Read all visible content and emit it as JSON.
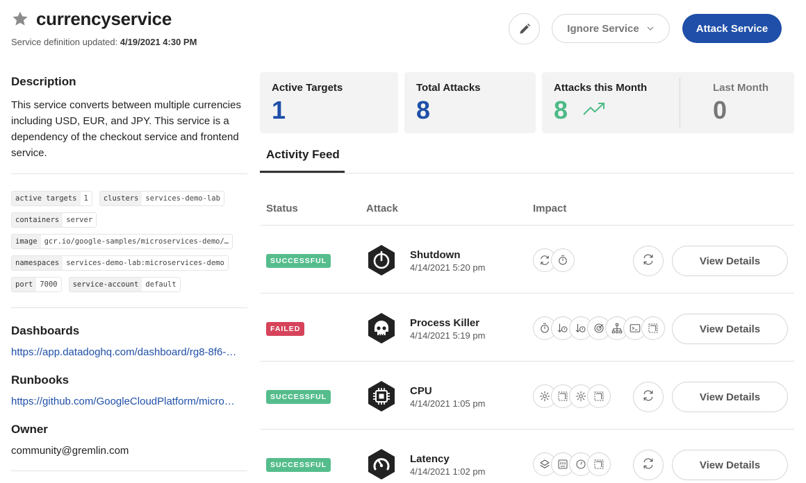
{
  "header": {
    "title": "currencyservice",
    "updated_label": "Service definition updated:",
    "updated_value": "4/19/2021 4:30 PM",
    "ignore_label": "Ignore Service",
    "attack_label": "Attack Service"
  },
  "description": {
    "heading": "Description",
    "text": "This service converts between multiple currencies including USD, EUR, and JPY. This service is a dependency of the checkout service and frontend service."
  },
  "tags": [
    {
      "key": "active targets",
      "value": "1"
    },
    {
      "key": "clusters",
      "value": "services-demo-lab"
    },
    {
      "key": "containers",
      "value": "server"
    },
    {
      "key": "image",
      "value": "gcr.io/google-samples/microservices-demo/…"
    },
    {
      "key": "namespaces",
      "value": "services-demo-lab:microservices-demo"
    },
    {
      "key": "port",
      "value": "7000"
    },
    {
      "key": "service-account",
      "value": "default"
    }
  ],
  "dashboards": {
    "heading": "Dashboards",
    "link": "https://app.datadoghq.com/dashboard/rg8-8f6-…"
  },
  "runbooks": {
    "heading": "Runbooks",
    "link": "https://github.com/GoogleCloudPlatform/micro…"
  },
  "owner": {
    "heading": "Owner",
    "value": "community@gremlin.com"
  },
  "stats": {
    "active_targets": {
      "label": "Active Targets",
      "value": "1"
    },
    "total_attacks": {
      "label": "Total Attacks",
      "value": "8"
    },
    "this_month": {
      "label": "Attacks this Month",
      "value": "8"
    },
    "last_month": {
      "label": "Last Month",
      "value": "0"
    }
  },
  "feed": {
    "tab_label": "Activity Feed",
    "columns": {
      "status": "Status",
      "attack": "Attack",
      "impact": "Impact"
    },
    "details_label": "View Details",
    "rows": [
      {
        "status": "SUCCESSFUL",
        "name": "Shutdown",
        "time": "4/14/2021 5:20 pm",
        "icon": "power-icon",
        "impacts": [
          "refresh-icon",
          "timer-icon"
        ],
        "rerun": true
      },
      {
        "status": "FAILED",
        "name": "Process Killer",
        "time": "4/14/2021 5:19 pm",
        "icon": "skull-icon",
        "impacts": [
          "timer-icon",
          "sort-timer-icon",
          "sort-timer-icon",
          "target-icon",
          "hierarchy-icon",
          "terminal-icon",
          "dashed-square-icon"
        ],
        "rerun": false
      },
      {
        "status": "SUCCESSFUL",
        "name": "CPU",
        "time": "4/14/2021 1:05 pm",
        "icon": "chip-icon",
        "impacts": [
          "gear-icon",
          "dashed-square-icon",
          "gear-icon",
          "dashed-square-icon"
        ],
        "rerun": true
      },
      {
        "status": "SUCCESSFUL",
        "name": "Latency",
        "time": "4/14/2021 1:02 pm",
        "icon": "gauge-icon",
        "impacts": [
          "layers-icon",
          "port-icon",
          "clock-icon",
          "dashed-square-icon"
        ],
        "rerun": true
      }
    ]
  },
  "colors": {
    "primary": "#1f4fa8",
    "success": "#55bd8c",
    "failed": "#d6435b",
    "trend": "#4dba87"
  }
}
